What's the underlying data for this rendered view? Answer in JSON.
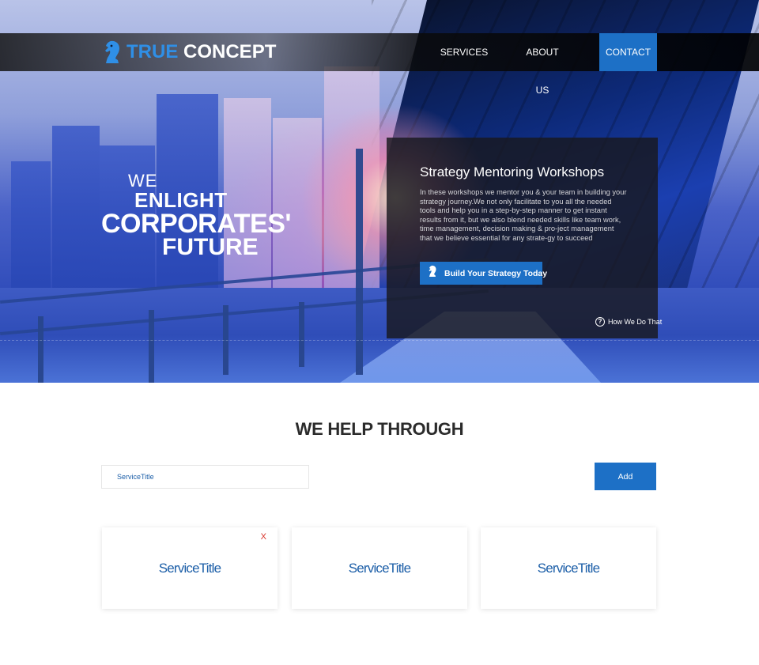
{
  "nav": {
    "logo_primary": "TRUE",
    "logo_secondary": "CONCEPT",
    "items": [
      {
        "label": "SERVICES"
      },
      {
        "label": "ABOUT US"
      },
      {
        "label": "CONTACT"
      }
    ]
  },
  "hero": {
    "headline": {
      "line1": "WE",
      "line2": "ENLIGHT",
      "line3": "CORPORATES'",
      "line4": "FUTURE"
    },
    "panel": {
      "title": "Strategy Mentoring Workshops",
      "body": "In these workshops we mentor you & your team in building your strategy journey.We not only facilitate to you all the needed tools and help you in a step-by-step manner to get instant results from it, but we also blend needed skills like team work, time management, decision making & pro-ject management that we believe essential for any strate-gy to succeed",
      "cta_label": "Build Your Strategy Today",
      "help_link": "How We Do That"
    }
  },
  "services_section": {
    "title": "WE HELP THROUGH",
    "input": {
      "placeholder": "ServiceTitle",
      "value": ""
    },
    "add_label": "Add",
    "cards": [
      {
        "title": "ServiceTitle",
        "close": "X"
      },
      {
        "title": "ServiceTitle"
      },
      {
        "title": "ServiceTitle"
      }
    ]
  },
  "colors": {
    "brand_blue": "#1d70c6",
    "title_blue": "#1d5fa8",
    "close_red": "#d9352b"
  }
}
